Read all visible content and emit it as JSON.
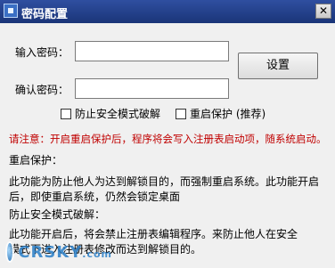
{
  "window": {
    "title": "密码配置",
    "close_label": "✕"
  },
  "form": {
    "password_label": "输入密码：",
    "password_value": "",
    "confirm_label": "确认密码：",
    "confirm_value": "",
    "setup_button": "设置"
  },
  "options": {
    "safe_mode_label": "防止安全模式破解",
    "safe_mode_checked": false,
    "restart_protect_label": "重启保护 (推荐)",
    "restart_protect_checked": false
  },
  "notice": "请注意：开启重启保护后，程序将会写入注册表启动项，随系统启动。",
  "restart_section": {
    "heading": "重启保护：",
    "line1": "此功能为防止他人为达到解锁目的，而强制重启系统。此功能开启",
    "line2": "后，即使重启系统，仍然会锁定桌面"
  },
  "safe_section": {
    "heading": "防止安全模式破解：",
    "line1": "此功能开启后，将会禁止注册表编辑程序。来防止他人在安全",
    "line2": "模式下进入注册表修改而达到解锁目的。"
  },
  "watermark": {
    "brand": "CRSKY",
    "suffix": ".com"
  }
}
